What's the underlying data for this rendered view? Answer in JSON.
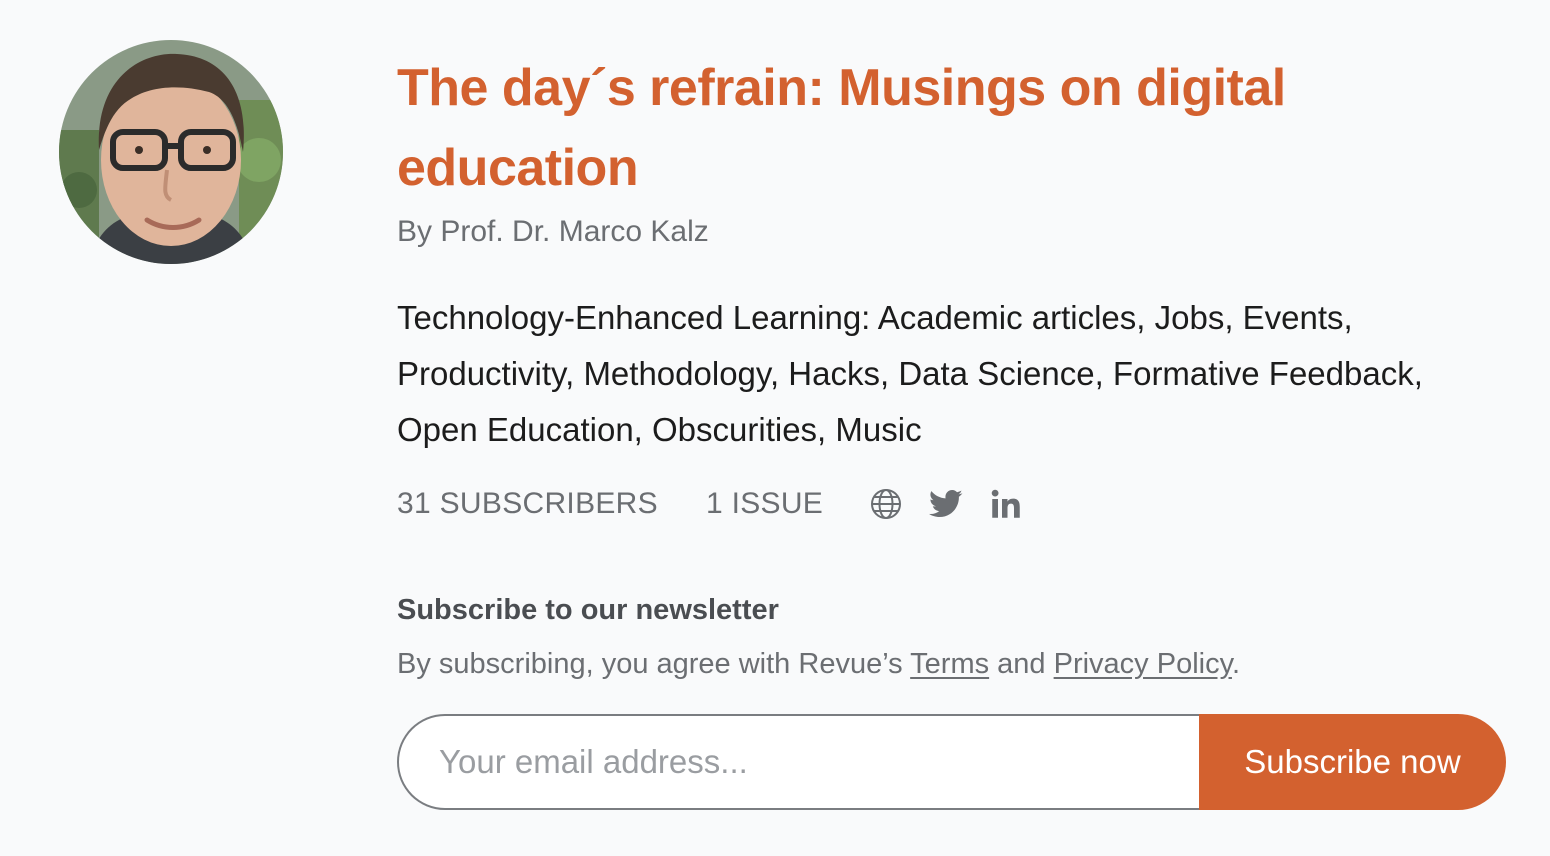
{
  "newsletter": {
    "title": "The day´s refrain: Musings on digital education",
    "author": "By Prof. Dr. Marco Kalz",
    "description": "Technology-Enhanced Learning: Academic articles, Jobs, Events, Productivity, Methodology, Hacks, Data Science, Formative Feedback, Open Education, Obscurities, Music"
  },
  "stats": {
    "subscribers": "31 SUBSCRIBERS",
    "issues": "1 ISSUE"
  },
  "social": [
    "globe-icon",
    "twitter-icon",
    "linkedin-icon"
  ],
  "subscribe": {
    "heading": "Subscribe to our newsletter",
    "terms_prefix": "By subscribing, you agree with Revue’s ",
    "terms_link": "Terms",
    "terms_middle": " and ",
    "privacy_link": "Privacy Policy",
    "terms_suffix": ".",
    "email_placeholder": "Your email address...",
    "button_label": "Subscribe now"
  },
  "colors": {
    "accent": "#d3612f",
    "background": "#f9fafb",
    "muted_text": "#6b6e72"
  }
}
